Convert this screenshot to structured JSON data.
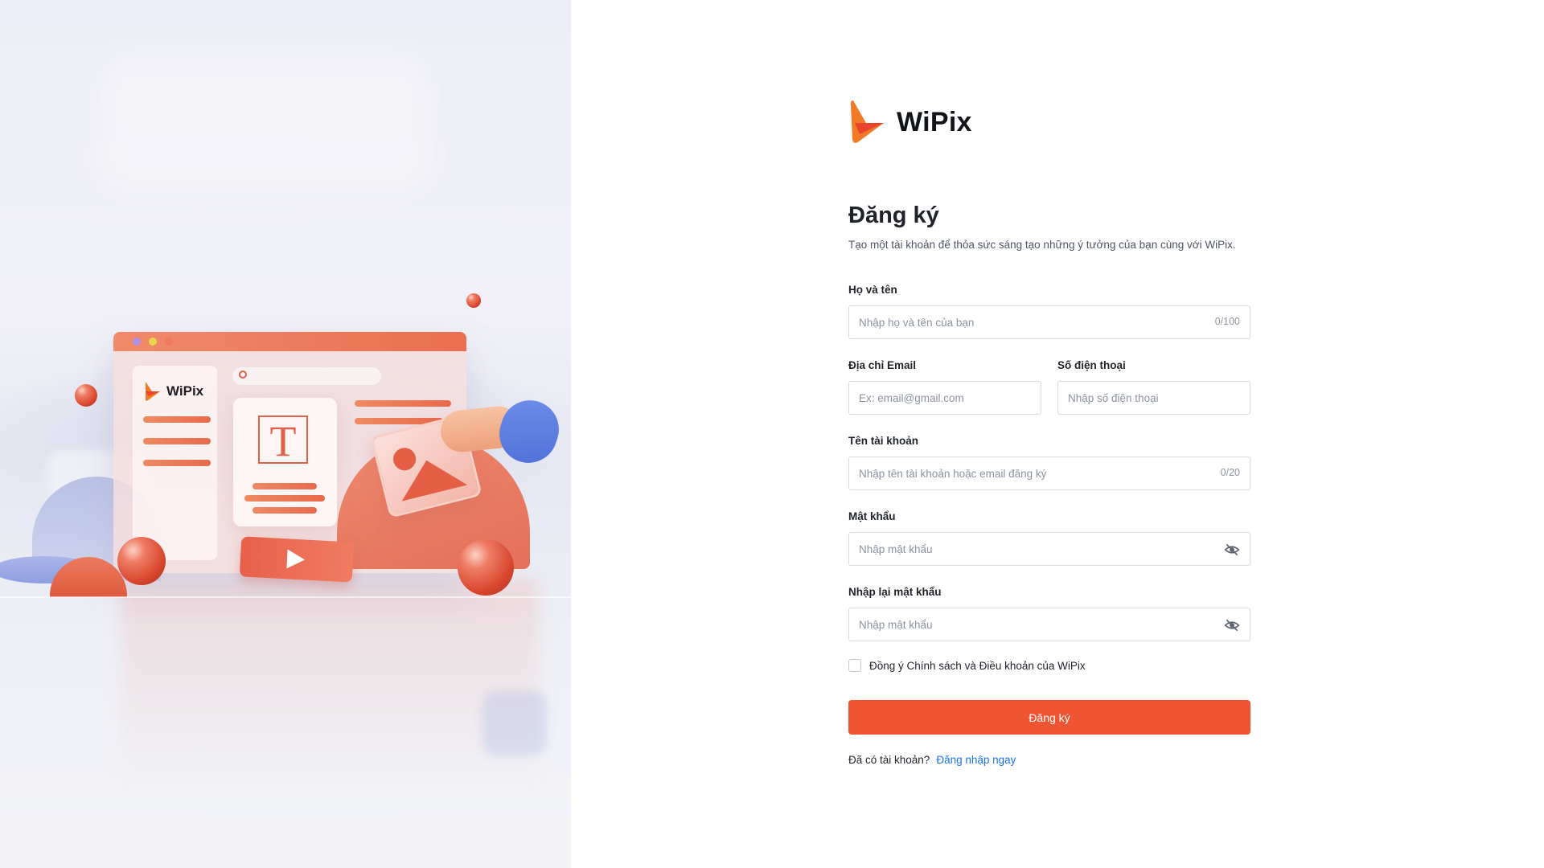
{
  "brand": {
    "name": "WiPix",
    "accent": "#f05533"
  },
  "hero": {
    "logo_text": "WiPix",
    "logo_letter": "T"
  },
  "form": {
    "title": "Đăng ký",
    "subtitle": "Tạo một tài khoản để thỏa sức sáng tạo những ý tưởng của bạn cùng với WiPix.",
    "full_name": {
      "label": "Họ và tên",
      "placeholder": "Nhập họ và tên của bạn",
      "value": "",
      "counter": "0/100"
    },
    "email": {
      "label": "Địa chỉ Email",
      "placeholder": "Ex: email@gmail.com",
      "value": ""
    },
    "phone": {
      "label": "Số điện thoại",
      "placeholder": "Nhập số điện thoại",
      "value": ""
    },
    "username": {
      "label": "Tên tài khoản",
      "placeholder": "Nhập tên tài khoản hoặc email đăng ký",
      "value": "",
      "counter": "0/20"
    },
    "password": {
      "label": "Mật khẩu",
      "placeholder": "Nhập mật khẩu",
      "value": "",
      "icon": "eye-off-icon"
    },
    "confirm_password": {
      "label": "Nhập lại mật khẩu",
      "placeholder": "Nhập mật khẩu",
      "value": "",
      "icon": "eye-off-icon"
    },
    "agree": {
      "label": "Đồng ý Chính sách và Điều khoản của WiPix",
      "checked": false
    },
    "submit_label": "Đăng ký",
    "login_prompt": "Đã có tài khoản?",
    "login_link": "Đăng nhập ngay"
  },
  "colors": {
    "primary_button": "#f05533",
    "link": "#1a73e8",
    "border": "#d7dbe2",
    "placeholder": "#8c93a0"
  }
}
